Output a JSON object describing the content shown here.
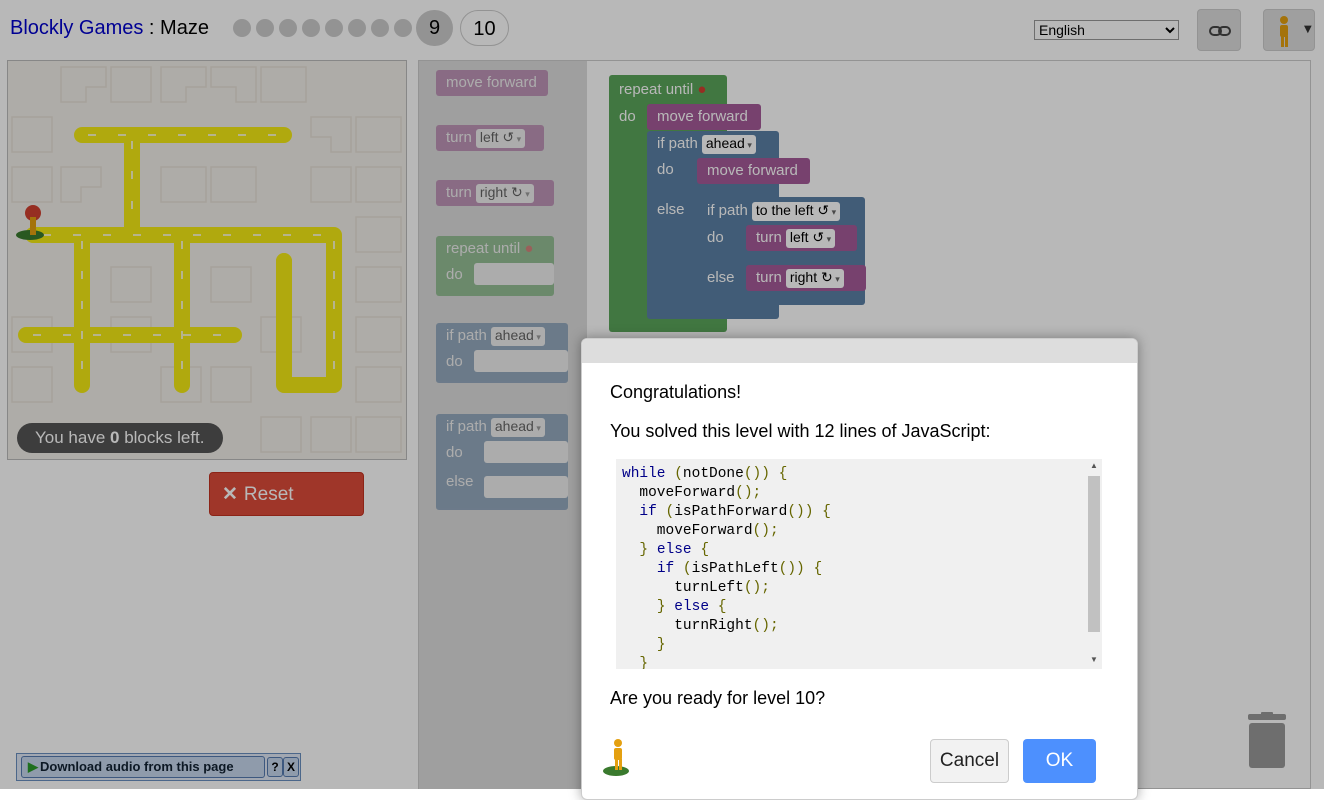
{
  "header": {
    "app_title": "Blockly Games",
    "separator": " : ",
    "page_title": "Maze",
    "levels_done": [
      "1",
      "2",
      "3",
      "4",
      "5",
      "6",
      "7",
      "8"
    ],
    "current_level": "9",
    "next_level": "10",
    "language": "English"
  },
  "maze": {
    "blocks_left_prefix": "You have ",
    "blocks_left_count": "0",
    "blocks_left_suffix": " blocks left."
  },
  "reset_button": "Reset",
  "flyout": {
    "move_forward": "move forward",
    "turn_left_label": "turn",
    "turn_left_dir": "left ↺",
    "turn_right_label": "turn",
    "turn_right_dir": "right ↻",
    "repeat_until": "repeat until",
    "repeat_do": "do",
    "if_path": "if path",
    "if_path_dir": "ahead",
    "if_do": "do",
    "ifelse_path": "if path",
    "ifelse_path_dir": "ahead",
    "ifelse_do": "do",
    "ifelse_else": "else"
  },
  "program": {
    "repeat_until": "repeat until",
    "repeat_do": "do",
    "move_forward_1": "move forward",
    "if_path": "if path",
    "if_dir": "ahead",
    "if_do": "do",
    "move_forward_2": "move forward",
    "if_else": "else",
    "inner_if_path": "if path",
    "inner_if_dir": "to the left ↺",
    "inner_do": "do",
    "turn_left_label": "turn",
    "turn_left_dir": "left ↺",
    "inner_else": "else",
    "turn_right_label": "turn",
    "turn_right_dir": "right ↻"
  },
  "audio_bar": {
    "download_label": "Download audio from this page",
    "help": "?",
    "close": "X"
  },
  "dialog": {
    "congrats": "Congratulations!",
    "solved_text": "You solved this level with 12 lines of JavaScript:",
    "question": "Are you ready for level 10?",
    "cancel": "Cancel",
    "ok": "OK",
    "code_lines": [
      "while (notDone()) {",
      "  moveForward();",
      "  if (isPathForward()) {",
      "    moveForward();",
      "  } else {",
      "    if (isPathLeft()) {",
      "      turnLeft();",
      "    } else {",
      "      turnRight();",
      "    }",
      "  }",
      "}"
    ]
  },
  "colors": {
    "path": "#f4ea14",
    "movement_block": "#a55b99",
    "logic_block": "#5b80a5",
    "loop_block": "#5ba55b",
    "reset": "#dd4b39",
    "ok": "#4d90fe"
  }
}
